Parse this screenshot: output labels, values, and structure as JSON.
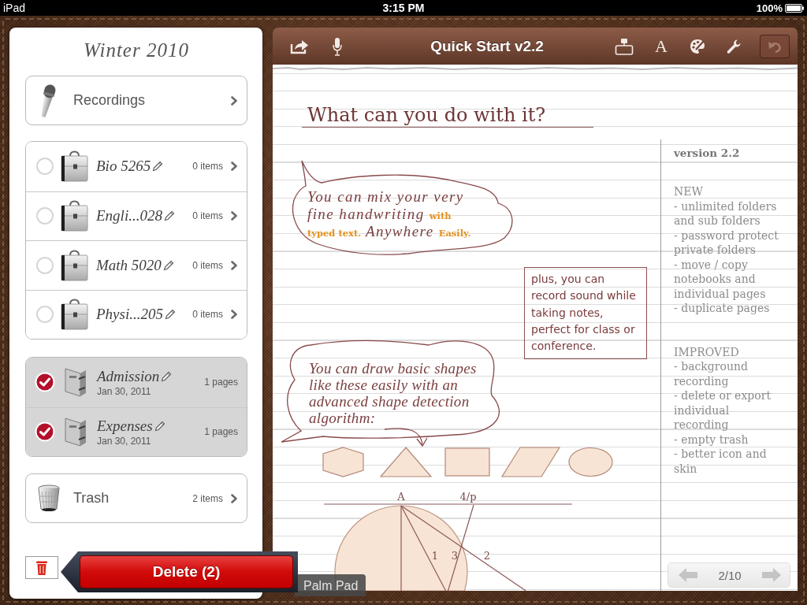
{
  "status_bar": {
    "device": "iPad",
    "time": "3:15 PM",
    "battery": "100%"
  },
  "sidebar": {
    "title": "Winter 2010",
    "recordings": {
      "label": "Recordings"
    },
    "folders": [
      {
        "name": "Bio 5265",
        "count": "0 items",
        "selected": false
      },
      {
        "name": "Engli...028",
        "count": "0 items",
        "selected": false
      },
      {
        "name": "Math 5020",
        "count": "0 items",
        "selected": false
      },
      {
        "name": "Physi...205",
        "count": "0 items",
        "selected": false
      }
    ],
    "notebooks": [
      {
        "name": "Admission",
        "date": "Jan 30, 2011",
        "count": "1 pages",
        "selected": true
      },
      {
        "name": "Expenses",
        "date": "Jan 30, 2011",
        "count": "1 pages",
        "selected": true
      }
    ],
    "trash": {
      "label": "Trash",
      "count": "2 items"
    }
  },
  "delete_popover": {
    "label": "Delete (2)"
  },
  "notebook_tab": {
    "label": "Palm Pad"
  },
  "notebook": {
    "toolbar": {
      "title": "Quick Start v2.2",
      "font_button": "A",
      "undo_disabled": true
    },
    "page": {
      "heading": "What can you do with it?",
      "bubbles": [
        "You can mix your very fine handwriting **with** **typed text.** Anywhere **Easily.**",
        "You can draw basic shapes like these easily with an advanced shape detection algorithm:"
      ],
      "note_box": "plus, you can record sound while taking notes, perfect for class or conference.",
      "diagram_labels": [
        "A",
        "4/p",
        "1",
        "3",
        "2"
      ],
      "changelog": {
        "title": "version 2.2",
        "sections": [
          {
            "heading": "NEW",
            "items": [
              "- unlimited folders and sub folders",
              "- password protect private folders",
              "- move / copy notebooks and individual pages",
              "- duplicate pages"
            ]
          },
          {
            "heading": "IMPROVED",
            "items": [
              "- background recording",
              "- delete or export individual recording",
              "- empty trash",
              "- better icon and skin"
            ]
          }
        ]
      },
      "pager": {
        "page": "2/10"
      }
    }
  }
}
